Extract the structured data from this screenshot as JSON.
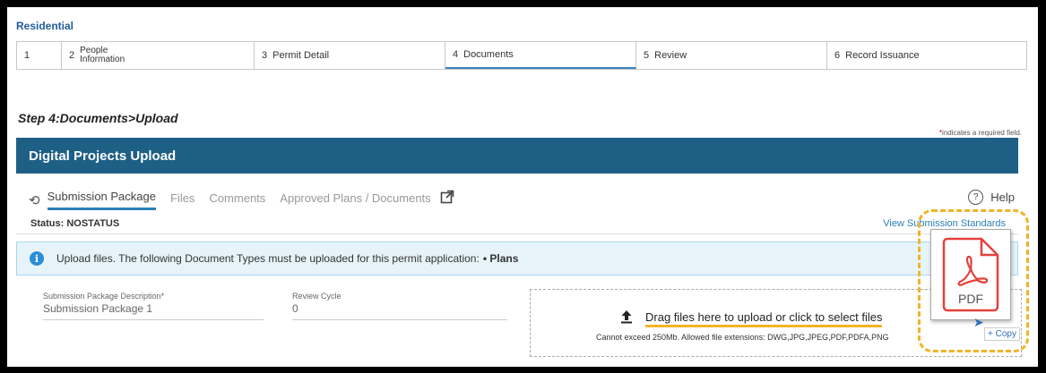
{
  "module": "Residential",
  "steps": [
    {
      "num": "1",
      "label": ""
    },
    {
      "num": "2",
      "label_line1": "People",
      "label_line2": "Information"
    },
    {
      "num": "3",
      "label": "Permit Detail"
    },
    {
      "num": "4",
      "label": "Documents"
    },
    {
      "num": "5",
      "label": "Review"
    },
    {
      "num": "6",
      "label": "Record Issuance"
    }
  ],
  "step_title": "Step 4:Documents>Upload",
  "required_note": {
    "star": "*",
    "text": "indicates a required field."
  },
  "banner_title": "Digital Projects Upload",
  "tabs": [
    "Submission Package",
    "Files",
    "Comments",
    "Approved Plans / Documents"
  ],
  "help_label": "Help",
  "status_text": "Status: NOSTATUS",
  "view_standards": "View Submission Standards",
  "info": {
    "text": "Upload files. The following Document Types must be uploaded for this permit application:",
    "item": "• Plans"
  },
  "fields": {
    "desc_label": "Submission Package Description*",
    "desc_value": "Submission Package 1",
    "cycle_label": "Review Cycle",
    "cycle_value": "0"
  },
  "dropzone": {
    "main": "Drag files here to upload or click to select files",
    "sub": "Cannot exceed 250Mb. Allowed file extensions: DWG,JPG,JPEG,PDF,PDFA,PNG"
  },
  "drag_preview": {
    "label": "PDF",
    "copy": "+ Copy"
  },
  "colors": {
    "banner": "#1e5f86",
    "accent": "#2b7fb8",
    "highlight": "#f0b429",
    "pdf_red": "#e4413c"
  }
}
